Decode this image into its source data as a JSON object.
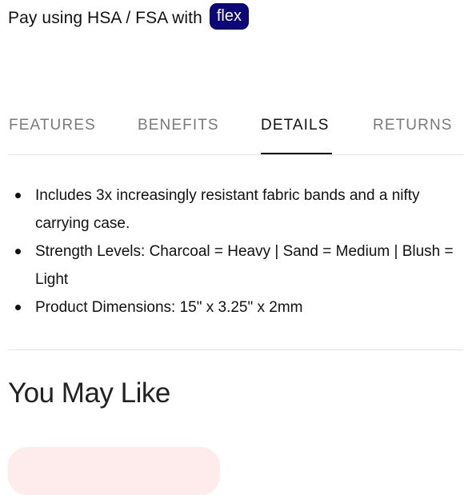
{
  "payment": {
    "text": "Pay using HSA / FSA with",
    "badge": "flex",
    "badge_color": "#0d0878"
  },
  "tabs": [
    {
      "label": "FEATURES",
      "active": false
    },
    {
      "label": "BENEFITS",
      "active": false
    },
    {
      "label": "DETAILS",
      "active": true
    },
    {
      "label": "RETURNS",
      "active": false
    }
  ],
  "details": {
    "items": [
      "Includes 3x increasingly resistant fabric bands and a nifty carrying case.",
      "Strength Levels: Charcoal = Heavy | Sand = Medium | Blush = Light",
      "Product Dimensions: 15\" x 3.25\" x 2mm"
    ]
  },
  "recommendations": {
    "title": "You May Like",
    "card_color": "#fdeceb"
  }
}
